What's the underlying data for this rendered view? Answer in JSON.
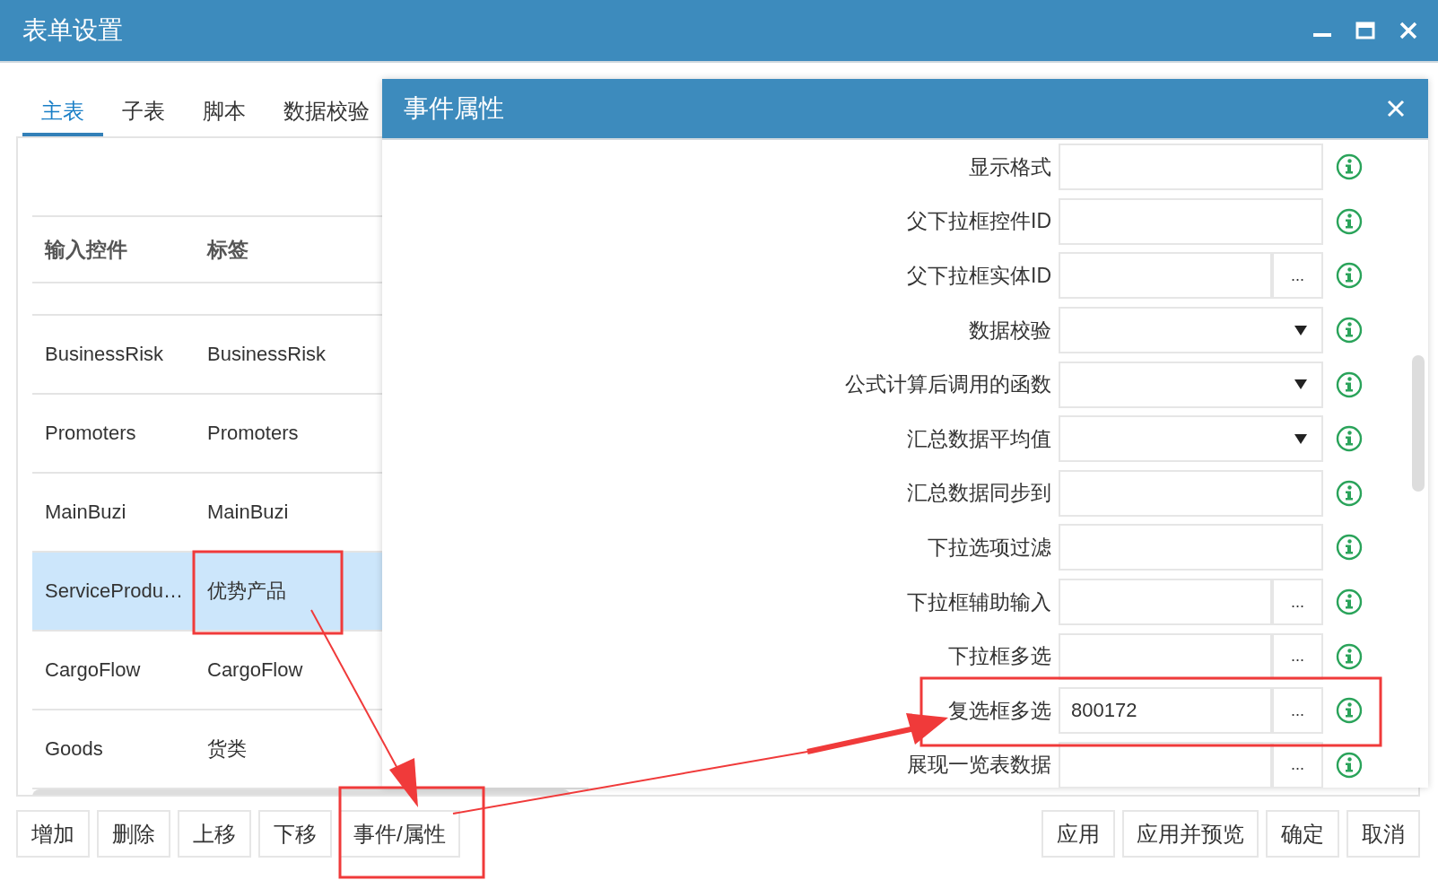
{
  "window": {
    "title": "表单设置"
  },
  "tabs": [
    {
      "label": "主表",
      "selected": true
    },
    {
      "label": "子表",
      "selected": false
    },
    {
      "label": "脚本",
      "selected": false
    },
    {
      "label": "数据校验",
      "selected": false
    }
  ],
  "table": {
    "columns": [
      "输入控件",
      "标签"
    ],
    "rows": [
      {
        "cells": [
          "BusinessRisk",
          "BusinessRisk"
        ],
        "selected": false
      },
      {
        "cells": [
          "Promoters",
          "Promoters"
        ],
        "selected": false
      },
      {
        "cells": [
          "MainBuzi",
          "MainBuzi"
        ],
        "selected": false
      },
      {
        "cells": [
          "ServiceProdu…",
          "优势产品"
        ],
        "selected": true
      },
      {
        "cells": [
          "CargoFlow",
          "CargoFlow"
        ],
        "selected": false
      },
      {
        "cells": [
          "Goods",
          "货类"
        ],
        "selected": false
      }
    ]
  },
  "left_buttons": [
    "增加",
    "删除",
    "上移",
    "下移",
    "事件/属性"
  ],
  "right_buttons": [
    "应用",
    "应用并预览",
    "确定",
    "取消"
  ],
  "dialog": {
    "title": "事件属性",
    "fields": [
      {
        "label": "显示格式",
        "kind": "text"
      },
      {
        "label": "父下拉框控件ID",
        "kind": "text"
      },
      {
        "label": "父下拉框实体ID",
        "kind": "picker",
        "button": "..."
      },
      {
        "label": "数据校验",
        "kind": "select"
      },
      {
        "label": "公式计算后调用的函数",
        "kind": "select"
      },
      {
        "label": "汇总数据平均值",
        "kind": "select"
      },
      {
        "label": "汇总数据同步到",
        "kind": "text"
      },
      {
        "label": "下拉选项过滤",
        "kind": "text"
      },
      {
        "label": "下拉框辅助输入",
        "kind": "picker",
        "button": "..."
      },
      {
        "label": "下拉框多选",
        "kind": "picker",
        "button": "..."
      },
      {
        "label": "复选框多选",
        "kind": "picker",
        "button": "...",
        "value": "800172"
      },
      {
        "label": "展现一览表数据",
        "kind": "picker",
        "button": "..."
      }
    ]
  }
}
